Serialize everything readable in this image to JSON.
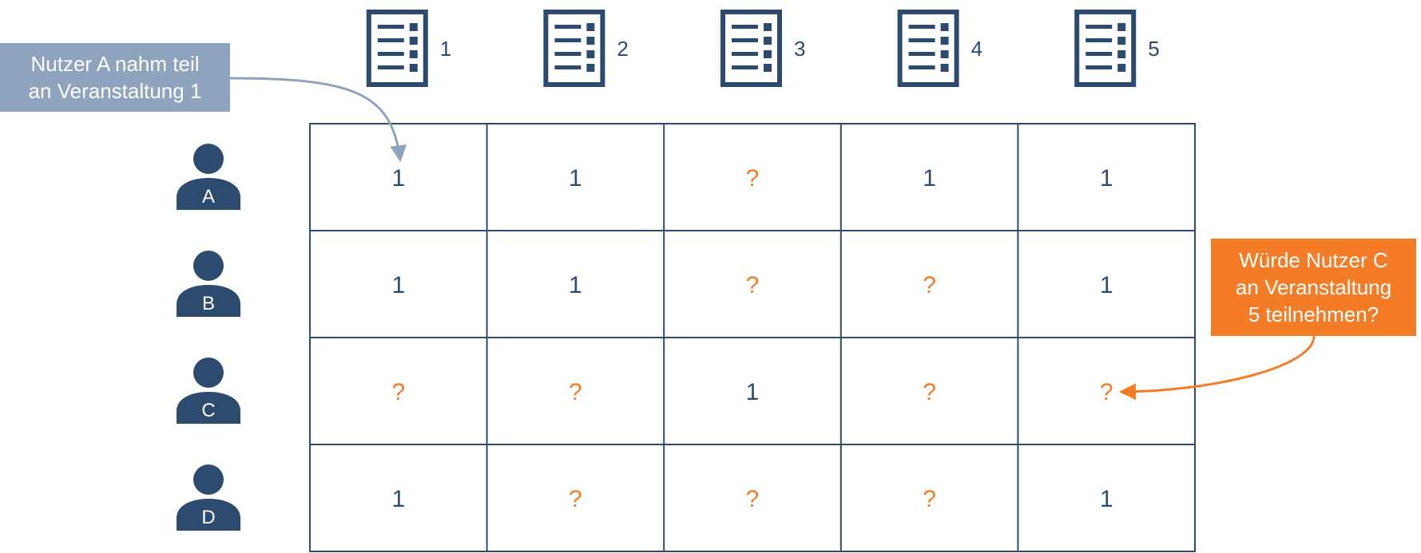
{
  "colors": {
    "navy": "#2d4b6e",
    "orange": "#f57c27",
    "callout_gray": "#8ea3bd",
    "grid_line": "#2d4b6e"
  },
  "icons": {
    "event": "document-list-icon",
    "user": "person-icon"
  },
  "events": [
    "1",
    "2",
    "3",
    "4",
    "5"
  ],
  "users": [
    "A",
    "B",
    "C",
    "D"
  ],
  "matrix": [
    [
      "1",
      "1",
      "?",
      "1",
      "1"
    ],
    [
      "1",
      "1",
      "?",
      "?",
      "1"
    ],
    [
      "?",
      "?",
      "1",
      "?",
      "?"
    ],
    [
      "1",
      "?",
      "?",
      "?",
      "1"
    ]
  ],
  "callouts": {
    "participation": {
      "lines": [
        "Nutzer A nahm teil",
        "an Veranstaltung 1"
      ],
      "target": {
        "row": 0,
        "col": 0
      }
    },
    "question": {
      "lines": [
        "Würde Nutzer C",
        "an Veranstaltung",
        "5 teilnehmen?"
      ],
      "target": {
        "row": 2,
        "col": 4
      }
    }
  }
}
